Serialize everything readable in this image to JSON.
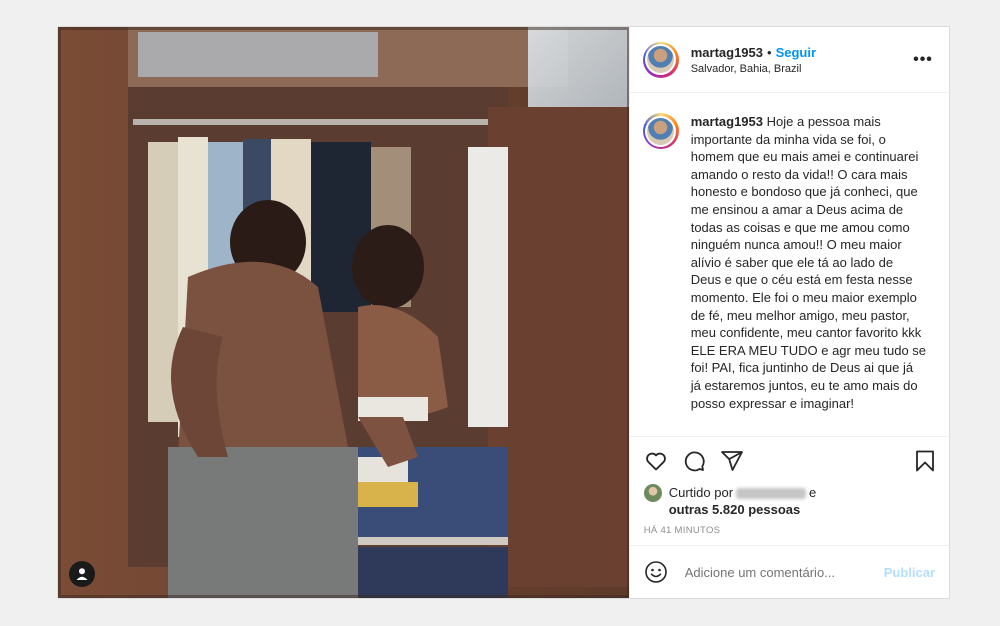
{
  "post": {
    "username": "martag1953",
    "separator": "•",
    "follow_label": "Seguir",
    "location": "Salvador, Bahia, Brazil",
    "more_label": "•••",
    "caption": "Hoje a pessoa mais importante da minha vida se foi, o homem que eu mais amei e continuarei amando o resto da vida!! O cara mais honesto e bondoso que já conheci, que me ensinou a amar a Deus acima de todas as coisas e que me amou como ninguém nunca amou!! O meu maior alívio é saber que ele tá ao lado de Deus e que o céu está em festa nesse momento. Ele foi o meu maior exemplo de fé, meu melhor amigo, meu pastor, meu confidente, meu cantor favorito kkk ELE ERA MEU TUDO e agr meu tudo se foi! PAI, fica juntinho de Deus ai que já já estaremos juntos, eu te amo mais do posso expressar e imaginar!",
    "liked_by_prefix": "Curtido por",
    "liked_by_conj": "e",
    "liked_others": "outras 5.820 pessoas",
    "timestamp": "HÁ 41 MINUTOS",
    "comment_placeholder": "Adicione um comentário...",
    "publish_label": "Publicar"
  },
  "icons": {
    "like": "heart-icon",
    "comment": "comment-icon",
    "share": "share-icon",
    "save": "bookmark-icon",
    "emoji": "emoji-icon",
    "tags": "user-tag-icon"
  },
  "colors": {
    "accent": "#0095f6",
    "publish_disabled": "#b2dffc",
    "muted": "#8e8e8e"
  }
}
